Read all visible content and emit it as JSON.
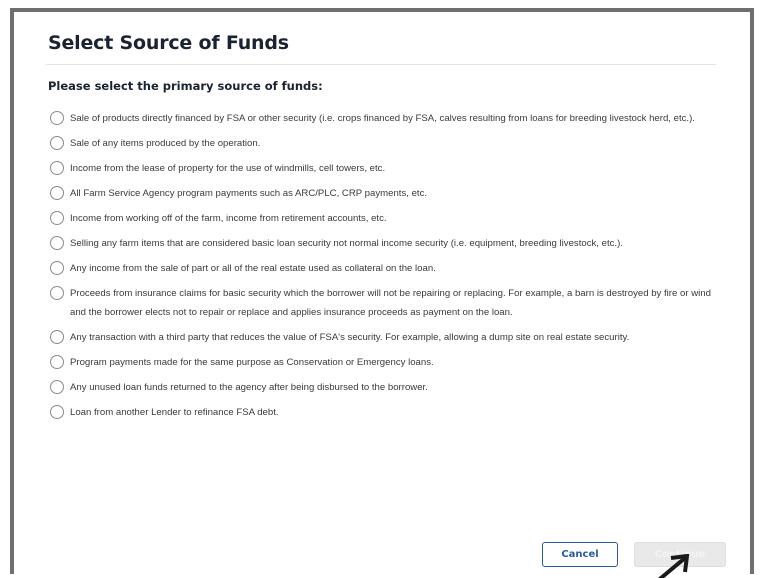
{
  "dialog": {
    "title": "Select Source of Funds",
    "prompt": "Please select the primary source of funds:",
    "options": [
      {
        "label": "Sale of products directly financed by FSA or other security (i.e. crops financed by FSA, calves resulting from loans for breeding livestock herd, etc.)."
      },
      {
        "label": "Sale of any items produced by the operation."
      },
      {
        "label": "Income from the lease of property for the use of windmills, cell towers, etc."
      },
      {
        "label": "All Farm Service Agency program payments such as ARC/PLC, CRP payments, etc."
      },
      {
        "label": "Income from working off of the farm, income from retirement accounts, etc."
      },
      {
        "label": "Selling any farm items that are considered basic loan security not normal income security (i.e. equipment, breeding livestock, etc.)."
      },
      {
        "label": "Any income from the sale of part or all of the real estate used as collateral on the loan."
      },
      {
        "label": "Proceeds from insurance claims for basic security which the borrower will not be repairing or replacing. For example, a barn is destroyed by fire or wind and the borrower elects not to repair or replace and applies insurance proceeds as payment on the loan."
      },
      {
        "label": "Any transaction with a third party that reduces the value of FSA's security. For example, allowing a dump site on real estate security."
      },
      {
        "label": "Program payments made for the same purpose as Conservation or Emergency loans."
      },
      {
        "label": "Any unused loan funds returned to the agency after being disbursed to the borrower."
      },
      {
        "label": "Loan from another Lender to refinance FSA debt."
      }
    ],
    "cancel_label": "Cancel",
    "continue_label": "Continue"
  }
}
